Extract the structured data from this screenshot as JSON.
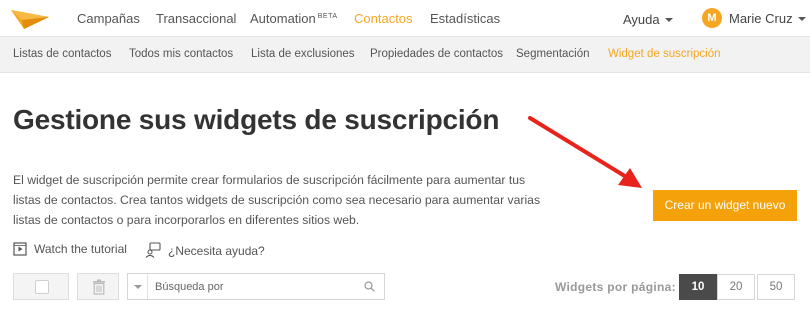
{
  "brand": {
    "logo_icon": "paper-plane-logo-icon",
    "accent": "#f5a623"
  },
  "topnav": {
    "items": [
      {
        "label": "Campañas"
      },
      {
        "label": "Transaccional"
      },
      {
        "label": "Automation",
        "badge": "BETA"
      },
      {
        "label": "Contactos",
        "active": true
      },
      {
        "label": "Estadísticas"
      }
    ],
    "help_label": "Ayuda",
    "user_initial": "M",
    "user_name": "Marie Cruz"
  },
  "subnav": {
    "items": [
      {
        "label": "Listas de contactos"
      },
      {
        "label": "Todos mis contactos"
      },
      {
        "label": "Lista de exclusiones"
      },
      {
        "label": "Propiedades de contactos"
      },
      {
        "label": "Segmentación"
      },
      {
        "label": "Widget de suscripción",
        "active": true
      }
    ]
  },
  "main": {
    "title": "Gestione sus widgets de suscripción",
    "description": "El widget de suscripción permite crear formularios de suscripción fácilmente para aumentar tus listas de contactos. Crea tantos widgets de suscripción como sea necesario para aumentar varias listas de contactos o para incorporarlos en diferentes sitios web.",
    "cta_label": "Crear un widget nuevo",
    "tutorial_label": "Watch the tutorial",
    "need_help_label": "¿Necesita ayuda?"
  },
  "toolbar": {
    "search_placeholder": "Búsqueda por",
    "per_page_label": "Widgets por página:",
    "per_page_options": [
      "10",
      "20",
      "50"
    ],
    "per_page_selected": "10"
  }
}
